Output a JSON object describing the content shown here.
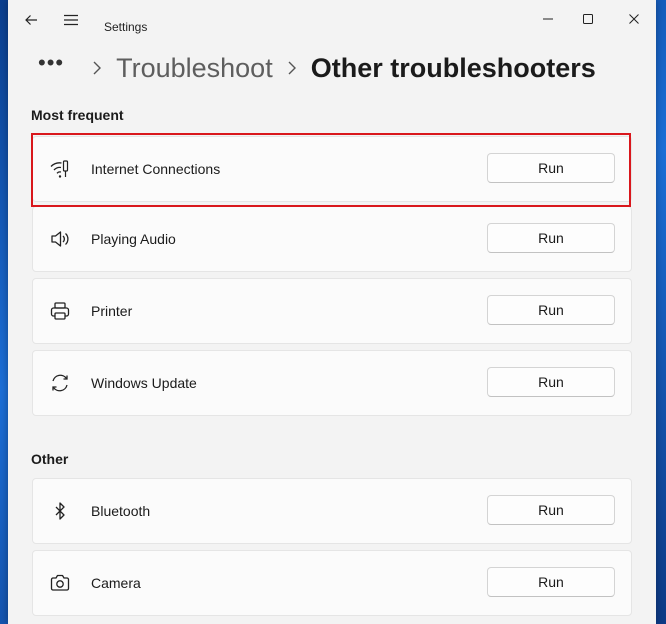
{
  "window": {
    "title": "Settings",
    "back_icon": "back-arrow-icon",
    "menu_icon": "hamburger-menu-icon"
  },
  "breadcrumb": {
    "more": "•••",
    "parent": "Troubleshoot",
    "current": "Other troubleshooters"
  },
  "sections": {
    "most_frequent": "Most frequent",
    "other": "Other"
  },
  "run_label": "Run",
  "most_frequent": [
    {
      "label": "Internet Connections",
      "icon": "wifi-icon"
    },
    {
      "label": "Playing Audio",
      "icon": "speaker-icon"
    },
    {
      "label": "Printer",
      "icon": "printer-icon"
    },
    {
      "label": "Windows Update",
      "icon": "refresh-icon"
    }
  ],
  "other": [
    {
      "label": "Bluetooth",
      "icon": "bluetooth-icon"
    },
    {
      "label": "Camera",
      "icon": "camera-icon"
    }
  ],
  "colors": {
    "highlight": "#d9171c",
    "background": "#f3f3f3",
    "card": "#fbfbfb"
  }
}
